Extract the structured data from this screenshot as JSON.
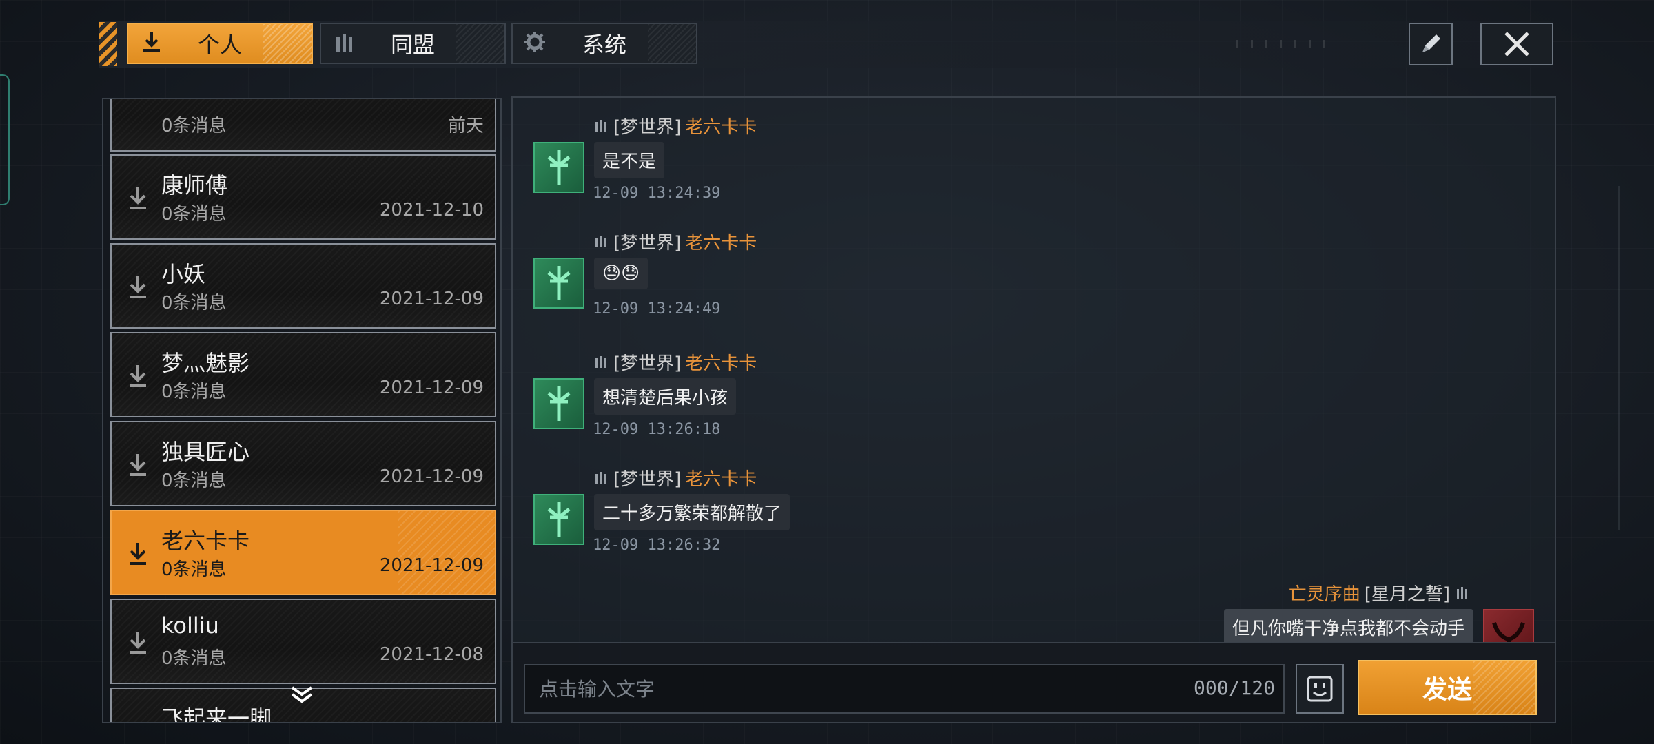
{
  "tabs": [
    {
      "label": "个人",
      "icon": "download-arrow-icon",
      "active": true
    },
    {
      "label": "同盟",
      "icon": "alliance-icon",
      "active": false
    },
    {
      "label": "系统",
      "icon": "gear-icon",
      "active": false
    }
  ],
  "contacts": [
    {
      "name": "",
      "count": "0条消息",
      "date": "前天",
      "partial": true
    },
    {
      "name": "康师傅",
      "count": "0条消息",
      "date": "2021-12-10"
    },
    {
      "name": "小妖",
      "count": "0条消息",
      "date": "2021-12-09"
    },
    {
      "name": "梦灬魅影",
      "count": "0条消息",
      "date": "2021-12-09"
    },
    {
      "name": "独具匠心",
      "count": "0条消息",
      "date": "2021-12-09"
    },
    {
      "name": "老六卡卡",
      "count": "0条消息",
      "date": "2021-12-09",
      "active": true
    },
    {
      "name": "kolliu",
      "count": "0条消息",
      "date": "2021-12-08"
    },
    {
      "name": "飞起来一脚",
      "count": "",
      "date": ""
    }
  ],
  "messages": [
    {
      "server": "[梦世界]",
      "sender": "老六卡卡",
      "text": "是不是",
      "time": "12-09 13:24:39"
    },
    {
      "server": "[梦世界]",
      "sender": "老六卡卡",
      "text": "😓😓",
      "time": "12-09 13:24:49"
    },
    {
      "server": "[梦世界]",
      "sender": "老六卡卡",
      "text": "想清楚后果小孩",
      "time": "12-09 13:26:18"
    },
    {
      "server": "[梦世界]",
      "sender": "老六卡卡",
      "text": "二十多万繁荣都解散了",
      "time": "12-09 13:26:32"
    }
  ],
  "self_message": {
    "sender": "亡灵序曲",
    "server": "[星月之誓]",
    "text": "但凡你嘴干净点我都不会动手"
  },
  "input": {
    "placeholder": "点击输入文字",
    "count": "000/120"
  },
  "send_label": "发送",
  "colors": {
    "accent": "#e88b22",
    "sender_name": "#e8933a"
  }
}
